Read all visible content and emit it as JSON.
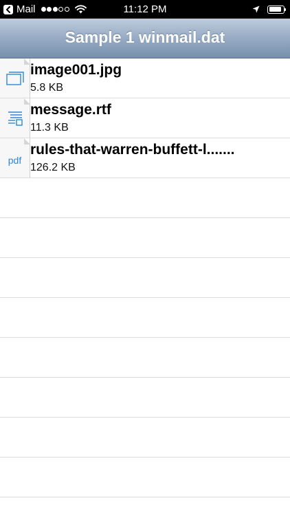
{
  "status_bar": {
    "back_app": "Mail",
    "time": "11:12 PM",
    "signal_bars_filled": 3,
    "signal_bars_total": 5,
    "battery_level": 0.9
  },
  "nav": {
    "title": "Sample 1 winmail.dat"
  },
  "files": [
    {
      "name": "image001.jpg",
      "size": "5.8 KB",
      "icon": "image-icon"
    },
    {
      "name": "message.rtf",
      "size": "11.3 KB",
      "icon": "document-lines-icon"
    },
    {
      "name": "rules-that-warren-buffett-l.......",
      "size": "126.2 KB",
      "icon": "pdf-icon",
      "icon_text": "pdf"
    }
  ],
  "colors": {
    "accent": "#2f86d8",
    "nav_bar_top": "#bfcddd",
    "nav_bar_bottom": "#7890ad"
  }
}
